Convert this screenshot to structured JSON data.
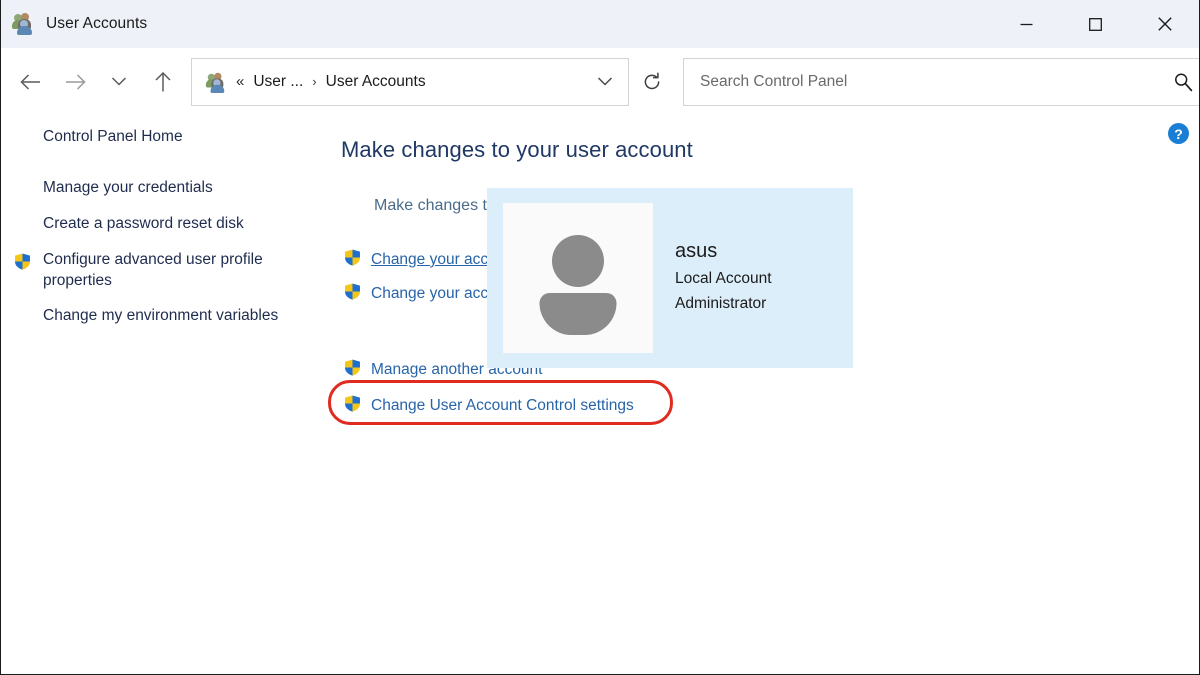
{
  "window": {
    "title": "User Accounts",
    "app_icon": "user-accounts-icon",
    "controls": {
      "minimize": "minimize-icon",
      "maximize": "maximize-icon",
      "close": "close-icon"
    }
  },
  "navbar": {
    "back": "back-arrow-icon",
    "forward": "forward-arrow-icon",
    "recent": "chevron-down-icon",
    "up": "up-arrow-icon",
    "breadcrumb": {
      "icon": "user-accounts-icon",
      "overflow": "«",
      "parent": "User ...",
      "separator": "›",
      "current": "User Accounts",
      "dropdown": "chevron-down-icon"
    },
    "refresh": "refresh-icon",
    "search": {
      "placeholder": "Search Control Panel",
      "value": "",
      "icon": "search-icon"
    }
  },
  "help": {
    "label": "?",
    "icon": "help-circle-icon"
  },
  "sidebar": {
    "items": [
      {
        "label": "Control Panel Home",
        "shield": false
      },
      {
        "label": "Manage your credentials",
        "shield": false
      },
      {
        "label": "Create a password reset disk",
        "shield": false
      },
      {
        "label": "Configure advanced user profile properties",
        "shield": true
      },
      {
        "label": "Change my environment variables",
        "shield": false
      }
    ]
  },
  "main": {
    "heading": "Make changes to your user account",
    "pc_settings_link": "Make changes to my account in PC settings",
    "account_links": [
      {
        "label": "Change your account name",
        "shield": true,
        "hovered": true
      },
      {
        "label": "Change your account type",
        "shield": true,
        "hovered": false
      }
    ],
    "manage_links": [
      {
        "label": "Manage another account",
        "shield": true,
        "hovered": false
      },
      {
        "label": "Change User Account Control settings",
        "shield": true,
        "hovered": false
      }
    ]
  },
  "account_panel": {
    "avatar": "user-avatar-icon",
    "name": "asus",
    "type": "Local Account",
    "role": "Administrator"
  },
  "colors": {
    "titlebar_bg": "#eef1f8",
    "heading": "#1f3864",
    "link": "#2864a8",
    "muted_link": "#4a6b8a",
    "sidebar_text": "#1f2c4d",
    "panel_bg": "#ddeefb",
    "highlight_red": "#e02b20",
    "help_blue": "#1a7fd4",
    "shield_yellow": "#f5c518",
    "shield_blue": "#1d6fd0"
  }
}
